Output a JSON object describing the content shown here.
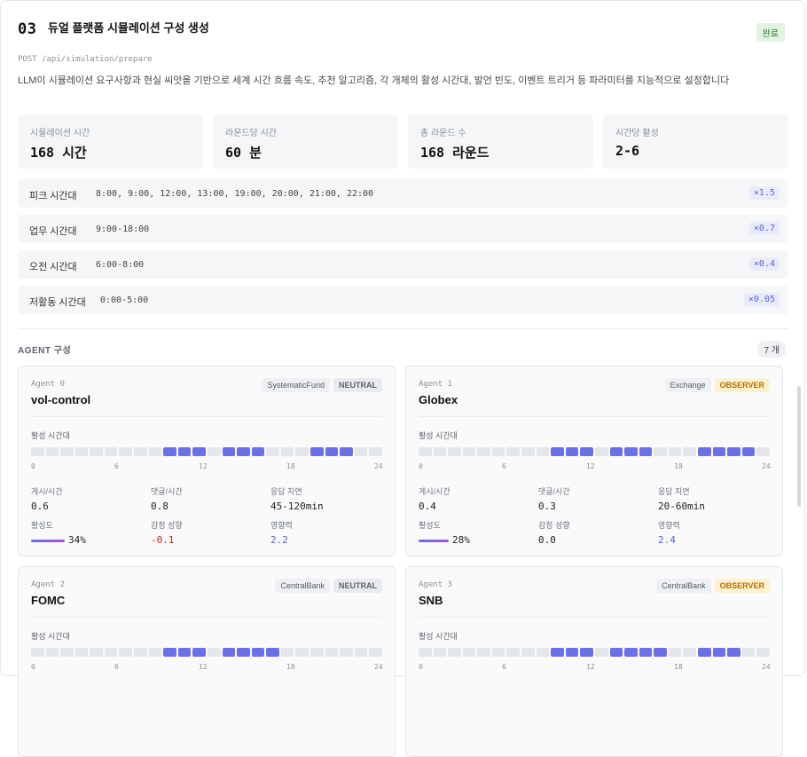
{
  "header": {
    "step": "03",
    "title": "듀얼 플랫폼 시뮬레이션 구성 생성",
    "status": "완료"
  },
  "endpoint": "POST /api/simulation/prepare",
  "description": "LLM이 시뮬레이션 요구사항과 현실 씨앗을 기반으로 세계 시간 흐름 속도, 추천 알고리즘, 각 개체의 활성 시간대, 발언 빈도, 이벤트 트리거 등 파라미터를 지능적으로 설정합니다",
  "stats": [
    {
      "label": "시뮬레이션 시간",
      "value": "168 시간"
    },
    {
      "label": "라운드당 시간",
      "value": "60 분"
    },
    {
      "label": "총 라운드 수",
      "value": "168 라운드"
    },
    {
      "label": "시간당 활성",
      "value": "2-6"
    }
  ],
  "time_zones": [
    {
      "name": "피크 시간대",
      "hours": "8:00, 9:00, 12:00, 13:00, 19:00, 20:00, 21:00, 22:00",
      "multiplier": "×1.5"
    },
    {
      "name": "업무 시간대",
      "hours": "9:00-18:00",
      "multiplier": "×0.7"
    },
    {
      "name": "오전 시간대",
      "hours": "6:00-8:00",
      "multiplier": "×0.4"
    },
    {
      "name": "저활동 시간대",
      "hours": "0:00-5:00",
      "multiplier": "×0.05"
    }
  ],
  "agents_section": {
    "title": "AGENT 구성",
    "count": "7 개"
  },
  "agent_labels": {
    "active_hours": "활성 시간대",
    "posts": "게시/시간",
    "comments": "댓글/시간",
    "delay": "응답 지연",
    "activity": "활성도",
    "sentiment": "감정 성향",
    "influence": "영향력",
    "ticks": [
      "0",
      "6",
      "12",
      "18",
      "24"
    ]
  },
  "agents": [
    {
      "id": "Agent 0",
      "name": "vol-control",
      "type": "SystematicFund",
      "stance": "NEUTRAL",
      "active_hours": [
        9,
        10,
        11,
        13,
        14,
        15,
        19,
        20,
        21
      ],
      "posts": "0.6",
      "comments": "0.8",
      "delay": "45-120min",
      "activity": "34%",
      "activity_level": 0.34,
      "sentiment": "-0.1",
      "influence": "2.2"
    },
    {
      "id": "Agent 1",
      "name": "Globex",
      "type": "Exchange",
      "stance": "OBSERVER",
      "active_hours": [
        9,
        10,
        11,
        13,
        14,
        15,
        19,
        20,
        21,
        22
      ],
      "posts": "0.4",
      "comments": "0.3",
      "delay": "20-60min",
      "activity": "28%",
      "activity_level": 0.28,
      "sentiment": "0.0",
      "influence": "2.4"
    },
    {
      "id": "Agent 2",
      "name": "FOMC",
      "type": "CentralBank",
      "stance": "NEUTRAL",
      "active_hours": [
        9,
        10,
        11,
        13,
        14,
        15,
        16
      ]
    },
    {
      "id": "Agent 3",
      "name": "SNB",
      "type": "CentralBank",
      "stance": "OBSERVER",
      "active_hours": [
        9,
        10,
        11,
        13,
        14,
        15,
        16,
        19,
        20,
        21
      ]
    }
  ],
  "colors": {
    "accent": "#6b70e8",
    "observer": "#b86f00",
    "done": "#2e7d32"
  }
}
